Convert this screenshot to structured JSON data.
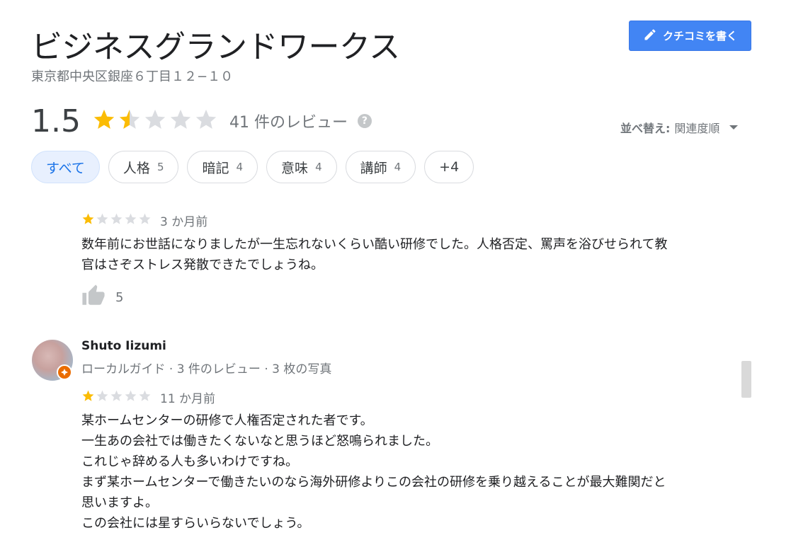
{
  "header": {
    "title": "ビジネスグランドワークス",
    "address": "東京都中央区銀座６丁目１２−１０",
    "write_review_label": "クチコミを書く"
  },
  "summary": {
    "rating": "1.5",
    "rating_value": 1.5,
    "review_count_label": "41 件のレビュー",
    "help_icon": "?"
  },
  "sort": {
    "label": "並べ替え:",
    "value": "関連度順"
  },
  "chips": [
    {
      "label": "すべて",
      "count": ""
    },
    {
      "label": "人格",
      "count": "5"
    },
    {
      "label": "暗記",
      "count": "4"
    },
    {
      "label": "意味",
      "count": "4"
    },
    {
      "label": "講師",
      "count": "4"
    },
    {
      "label": "+4",
      "count": ""
    }
  ],
  "reviews": [
    {
      "stars": 1,
      "time_ago": "3 か月前",
      "lines": [
        "数年前にお世話になりましたが一生忘れないくらい酷い研修でした。人格否定、罵声を浴びせられて教",
        "官はさぞストレス発散できたでしょうね。"
      ],
      "likes": "5"
    },
    {
      "author": "Shuto Iizumi",
      "author_meta": "ローカルガイド · 3 件のレビュー · 3 枚の写真",
      "stars": 1,
      "time_ago": "11 か月前",
      "lines": [
        "某ホームセンターの研修で人権否定された者です。",
        "一生あの会社では働きたくないなと思うほど怒鳴られました。",
        "これじゃ辞める人も多いわけですね。",
        "まず某ホームセンターで働きたいのなら海外研修よりこの会社の研修を乗り越えることが最大難関だと",
        "思いますよ。",
        "この会社には星すらいらないでしょう。"
      ]
    }
  ],
  "colors": {
    "star_filled": "#fbbc04",
    "star_empty": "#dadce0",
    "accent": "#4285f4",
    "chip_active_bg": "#e8f0fe",
    "local_guide_badge": "#ea6c00"
  }
}
